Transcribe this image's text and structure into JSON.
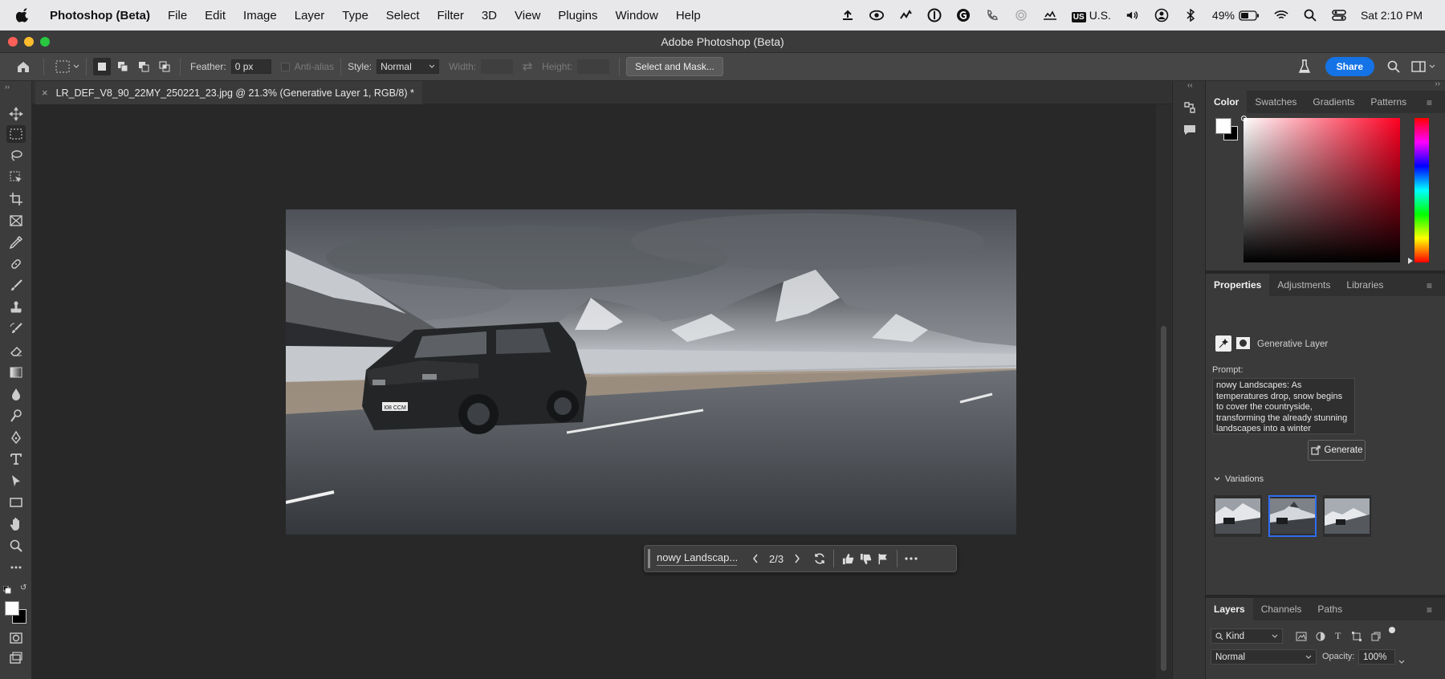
{
  "menubar": {
    "app_name": "Photoshop (Beta)",
    "items": [
      "File",
      "Edit",
      "Image",
      "Layer",
      "Type",
      "Select",
      "Filter",
      "3D",
      "View",
      "Plugins",
      "Window",
      "Help"
    ],
    "input_source": "U.S.",
    "input_badge": "US",
    "battery": "49%",
    "clock": "Sat  2:10 PM"
  },
  "window": {
    "title": "Adobe Photoshop (Beta)"
  },
  "options": {
    "feather_label": "Feather:",
    "feather_value": "0 px",
    "antialias_label": "Anti-alias",
    "style_label": "Style:",
    "style_value": "Normal",
    "width_label": "Width:",
    "height_label": "Height:",
    "select_mask": "Select and Mask...",
    "share": "Share"
  },
  "document": {
    "tab_title": "LR_DEF_V8_90_22MY_250221_23.jpg @ 21.3% (Generative Layer 1, RGB/8) *",
    "plate_text": "I08 CCM"
  },
  "gen_toolbar": {
    "prompt_short": "nowy Landscap...",
    "counter": "2/3"
  },
  "color_panel": {
    "tabs": [
      "Color",
      "Swatches",
      "Gradients",
      "Patterns"
    ],
    "active_tab": "Color",
    "foreground": "#ffffff",
    "background": "#000000"
  },
  "properties_panel": {
    "tabs": [
      "Properties",
      "Adjustments",
      "Libraries"
    ],
    "active_tab": "Properties",
    "layer_type": "Generative Layer",
    "prompt_label": "Prompt:",
    "prompt_text": "nowy Landscapes: As temperatures drop, snow begins to cover the countryside, transforming the already stunning landscapes into a winter wonderland. The mountainous regions,",
    "generate_label": "Generate",
    "variations_label": "Variations",
    "selected_variation": 2
  },
  "layers_panel": {
    "tabs": [
      "Layers",
      "Channels",
      "Paths"
    ],
    "active_tab": "Layers",
    "filter_value": "Kind",
    "blend_mode": "Normal",
    "opacity_label": "Opacity:",
    "opacity_value": "100%"
  }
}
